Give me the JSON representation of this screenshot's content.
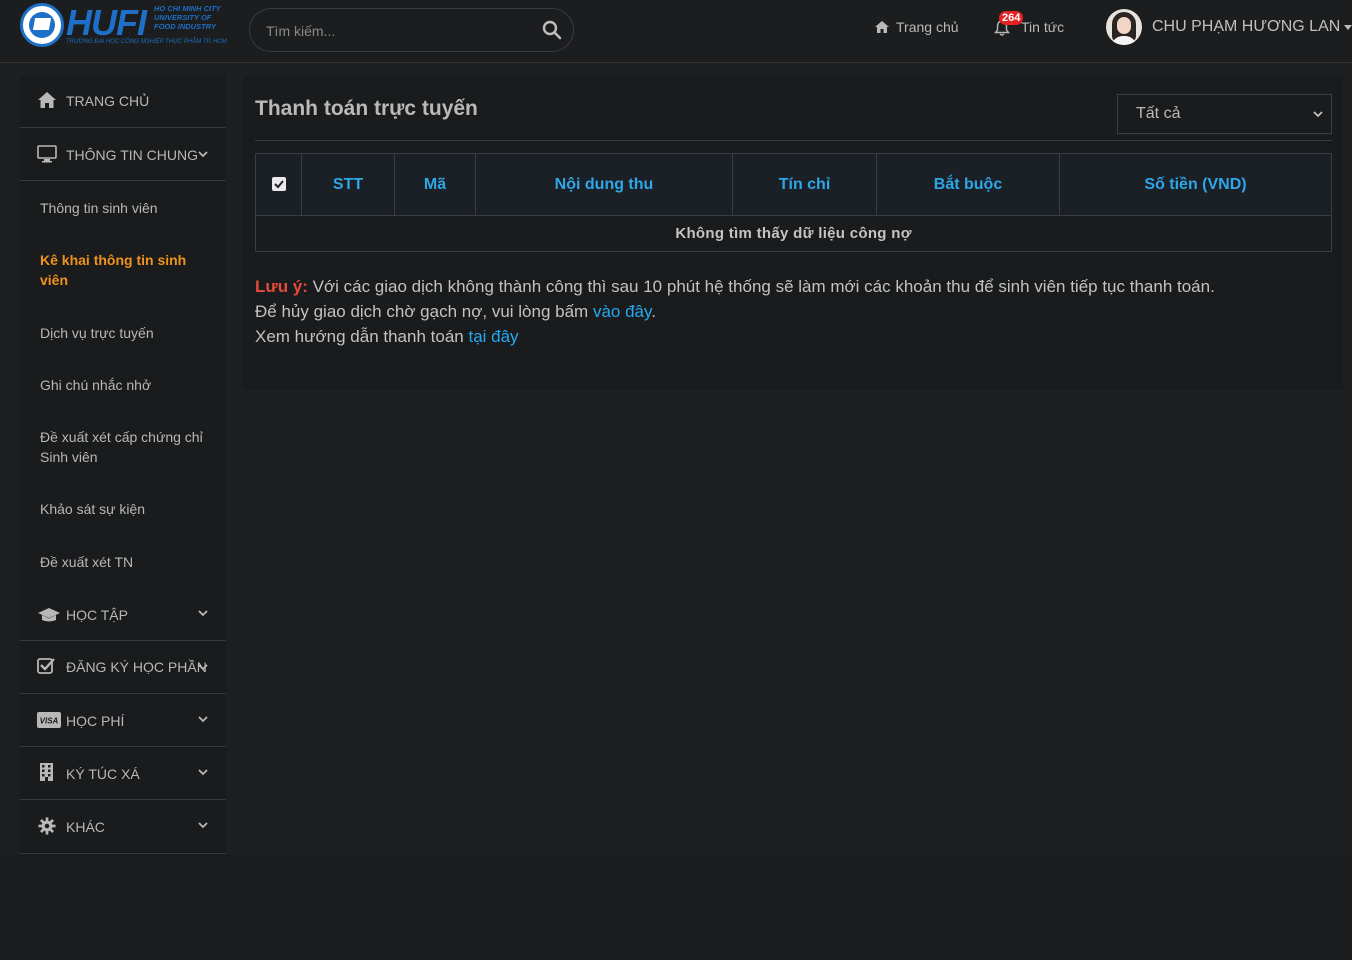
{
  "brand": {
    "logo_text": "HUFI",
    "logo_sub": "HO CHI MINH CITY UNIVERSITY OF FOOD INDUSTRY",
    "logo_sub2": "TRƯỜNG ĐẠI HỌC CÔNG NGHIỆP THỰC PHẨM TP. HCM",
    "accent": "#1d6fc7"
  },
  "header": {
    "search_placeholder": "Tìm kiếm...",
    "nav_home": "Trang chủ",
    "nav_news": "Tin tức",
    "news_badge": "264",
    "user_name": "CHU PHẠM HƯƠNG LAN"
  },
  "sidebar": {
    "items": [
      {
        "label": "TRANG CHỦ",
        "icon": "home-icon"
      },
      {
        "label": "THÔNG TIN CHUNG",
        "icon": "monitor-icon"
      }
    ],
    "sub_items": [
      {
        "label": "Thông tin sinh viên"
      },
      {
        "label": "Kê khai thông tin sinh viên"
      },
      {
        "label": "Dịch vụ trực tuyến"
      },
      {
        "label": "Ghi chú nhắc nhở"
      },
      {
        "label": "Đề xuất xét cấp chứng chỉ Sinh viên"
      },
      {
        "label": "Khảo sát sự kiện"
      },
      {
        "label": "Đề xuất xét TN"
      }
    ],
    "bottom_items": [
      {
        "label": "HỌC TẬP",
        "icon": "graduation-cap-icon"
      },
      {
        "label": "ĐĂNG KÝ HỌC PHẦN",
        "icon": "check-square-icon"
      },
      {
        "label": "HỌC PHÍ",
        "icon": "visa-card-icon"
      },
      {
        "label": "KÝ TÚC XÁ",
        "icon": "building-icon"
      },
      {
        "label": "KHÁC",
        "icon": "gear-icon"
      }
    ],
    "active_color": "#f0931d"
  },
  "main": {
    "title": "Thanh toán trực tuyến",
    "filter_value": "Tất cả",
    "table": {
      "headers": [
        "STT",
        "Mã",
        "Nội dung thu",
        "Tín chỉ",
        "Bắt buộc",
        "Số tiền (VND)"
      ],
      "empty_message": "Không tìm thấy dữ liệu công nợ"
    },
    "notes": {
      "warn_label": "Lưu ý:",
      "line1": " Với các giao dịch không thành công thì sau 10 phút hệ thống sẽ làm mới các khoản thu để sinh viên tiếp tục thanh toán.",
      "line2_prefix": "Để hủy giao dịch chờ gạch nợ, vui lòng bấm ",
      "line2_link": "vào đây",
      "line2_suffix": ".",
      "line3_prefix": "Xem hướng dẫn thanh toán ",
      "line3_link": "tại đây"
    },
    "link_color": "#27a8f0",
    "header_color": "#2ea6e8"
  }
}
